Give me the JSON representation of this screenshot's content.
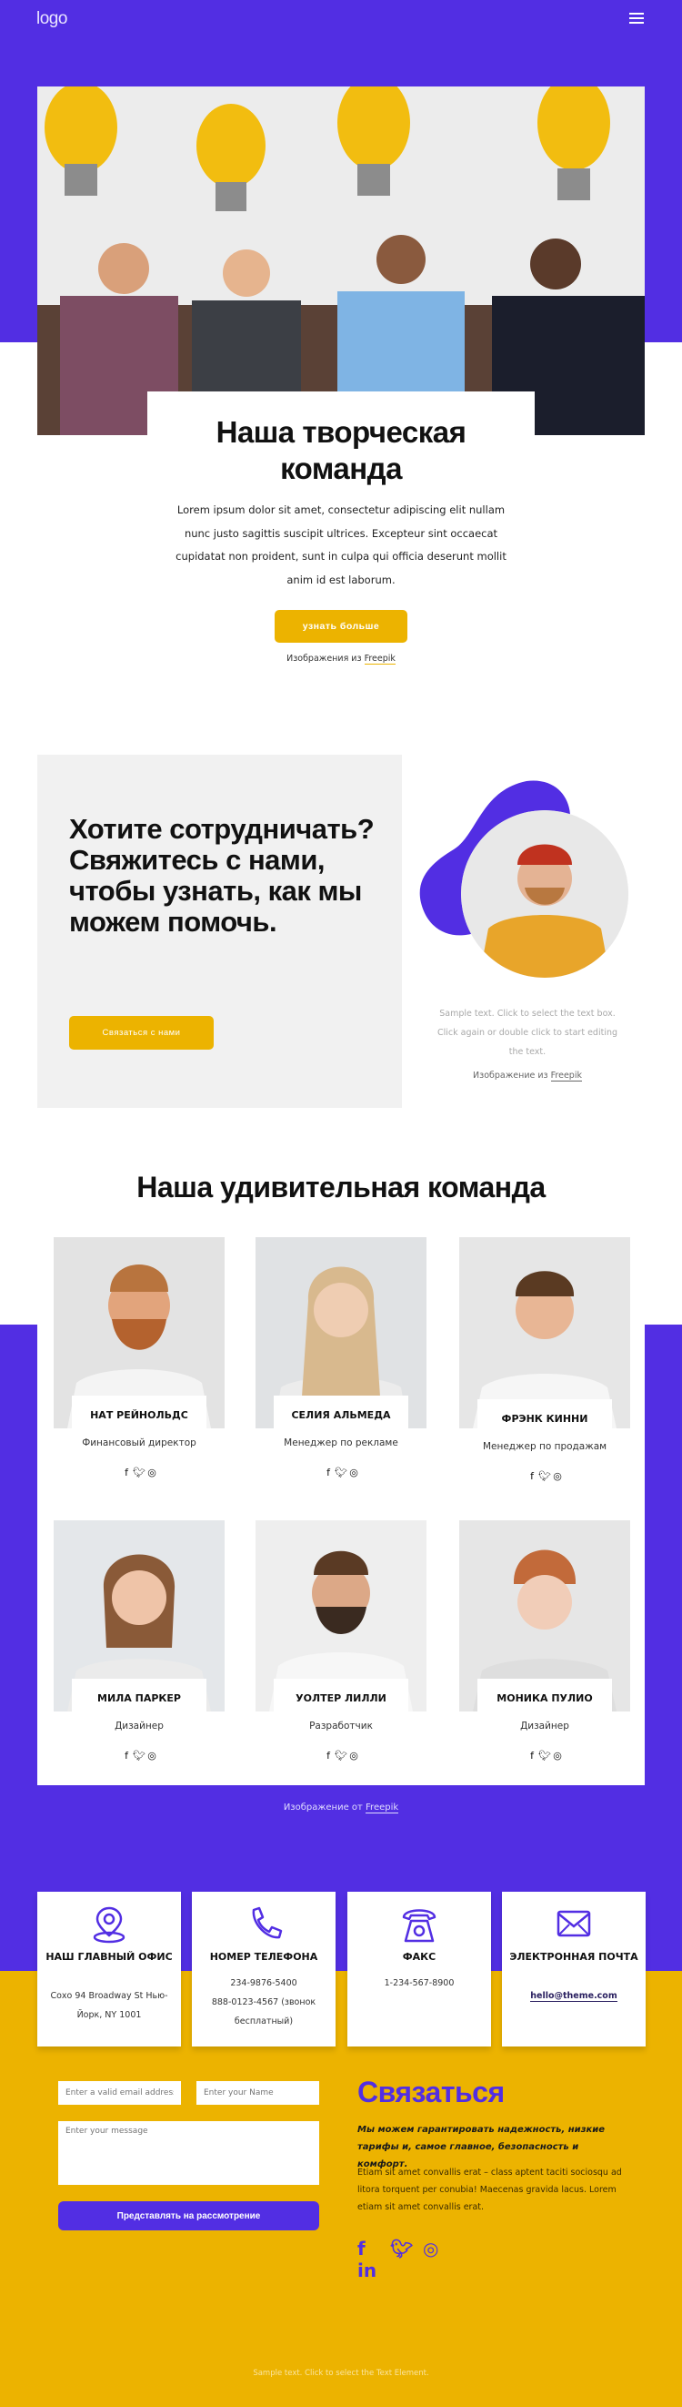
{
  "header": {
    "logo": "logo",
    "menu_icon": "hamburger-menu-icon"
  },
  "hero": {
    "title_line1": "Наша творческая",
    "title_line2": "команда",
    "text": "Lorem ipsum dolor sit amet, consectetur adipiscing elit nullam nunc justo sagittis suscipit ultrices. Excepteur sint occaecat cupidatat non proident, sunt in culpa qui officia deserunt mollit anim id est laborum.",
    "button": "узнать больше",
    "credit_prefix": "Изображения из",
    "credit_link": "Freepik"
  },
  "collaborate": {
    "title": "Хотите сотрудничать? Свяжитесь с нами, чтобы узнать, как мы можем помочь.",
    "button": "Связаться с нами",
    "sample_text": "Sample text. Click to select the text box. Click again or double click to start editing the text.",
    "credit_prefix": "Изображение из",
    "credit_link": "Freepik"
  },
  "team": {
    "title": "Наша удивительная команда",
    "members": [
      {
        "name": "НАТ РЕЙНОЛЬДС",
        "role": "Финансовый директор"
      },
      {
        "name": "СЕЛИЯ АЛЬМЕДА",
        "role": "Менеджер по рекламе"
      },
      {
        "name": "ФРЭНК КИННИ",
        "role": "Менеджер по продажам"
      },
      {
        "name": "МИЛА ПАРКЕР",
        "role": "Дизайнер"
      },
      {
        "name": "УОЛТЕР ЛИЛЛИ",
        "role": "Разработчик"
      },
      {
        "name": "МОНИКА ПУЛИО",
        "role": "Дизайнер"
      }
    ],
    "social_icons": [
      "f",
      "𝕥",
      "◎"
    ],
    "credit_prefix": "Изображение от",
    "credit_link": "Freepik"
  },
  "contact_cards": [
    {
      "icon": "location-pin-icon",
      "title": "НАШ ГЛАВНЫЙ ОФИС",
      "lines": [
        "Сохо 94 Broadway St Нью-",
        "Йорк, NY 1001"
      ]
    },
    {
      "icon": "phone-icon",
      "title": "НОМЕР ТЕЛЕФОНА",
      "lines": [
        "234-9876-5400",
        "888-0123-4567 (звонок",
        "бесплатный)"
      ]
    },
    {
      "icon": "fax-icon",
      "title": "ФАКС",
      "lines": [
        "1-234-567-8900"
      ]
    },
    {
      "icon": "envelope-icon",
      "title": "ЭЛЕКТРОННАЯ ПОЧТА",
      "email": "hello@theme.com"
    }
  ],
  "form": {
    "email_placeholder": "Enter a valid email address",
    "name_placeholder": "Enter your Name",
    "message_placeholder": "Enter your message",
    "submit": "Представлять на рассмотрение"
  },
  "contact": {
    "title": "Связаться",
    "lead": "Мы можем гарантировать надежность, низкие тарифы и, самое главное, безопасность и комфорт.",
    "body": "Etiam sit amet convallis erat – class aptent taciti sociosqu ad litora torquent per conubia! Maecenas gravida lacus. Lorem etiam sit amet convallis erat.",
    "socials": [
      "f",
      "t",
      "◎",
      "in"
    ]
  },
  "footer": {
    "text": "Sample text. Click to select the Text Element."
  },
  "colors": {
    "purple": "#522ee3",
    "yellow": "#ecb300"
  }
}
